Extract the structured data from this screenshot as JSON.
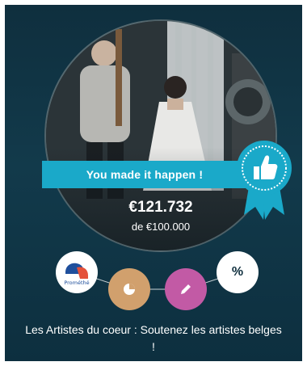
{
  "banner": {
    "label": "You made it happen !"
  },
  "funding": {
    "amount": "€121.732",
    "goal": "de €100.000"
  },
  "badges": {
    "logo_text": "Prométhé",
    "percent_symbol": "%"
  },
  "project": {
    "title": "Les Artistes du coeur : Soutenez les artistes belges !"
  },
  "colors": {
    "background": "#0f2f3e",
    "banner": "#1aa9c9",
    "badge_pie": "#d1a06d",
    "badge_pen": "#c25aa5"
  },
  "icons": {
    "award": "thumbs-up-ribbon-icon",
    "pie": "pie-chart-icon",
    "pen": "pencil-icon",
    "percent": "percent-icon"
  }
}
